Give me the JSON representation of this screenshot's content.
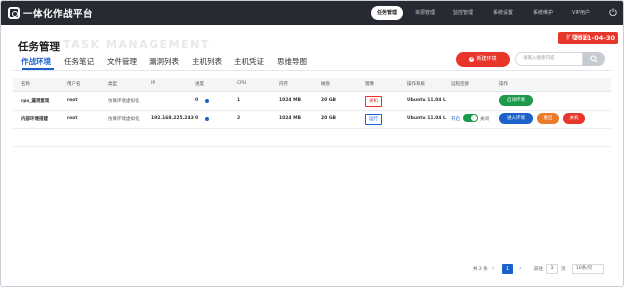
{
  "header": {
    "app_title": "一体化作战平台",
    "nav": [
      "任务管理",
      "资源管理",
      "监控管理",
      "系统设置",
      "系统维护",
      "VIP用户"
    ],
    "active_nav": "任务管理"
  },
  "date_tag": {
    "label": "扩展时间",
    "value": "2021-04-30"
  },
  "page": {
    "title": "任务管理",
    "subtitle": "TASK MANAGEMENT",
    "tabs": [
      "作战环境",
      "任务笔记",
      "文件管理",
      "漏洞列表",
      "主机列表",
      "主机凭证",
      "思维导图"
    ],
    "active_tab": "作战环境"
  },
  "toolbar": {
    "new_label": "新建环境",
    "search_placeholder": "请输入搜索内容"
  },
  "table": {
    "headers": [
      "名称",
      "用户名",
      "类型",
      "IP",
      "进度",
      "CPU",
      "内存",
      "磁盘",
      "镜像",
      "操作系统",
      "远程连接",
      "操作"
    ],
    "rows": [
      {
        "name": "rps_漏洞复现",
        "user": "root",
        "type": "仿真环境虚拟化",
        "ip": "",
        "progress": "0",
        "cpu": "1",
        "mem": "1024 MB",
        "disk": "20 GB",
        "image_tag": "关机",
        "os": "Ubuntu 11.04 L",
        "remote": "",
        "actions": [
          "启动环境"
        ]
      },
      {
        "name": "内部环境搭建",
        "user": "root",
        "type": "仿真环境虚拟化",
        "ip": "192.168.225.243",
        "progress": "0",
        "cpu": "2",
        "mem": "1024 MB",
        "disk": "20 GB",
        "image_tag": "运行",
        "os": "Ubuntu 11.04 L",
        "remote_label_on": "开启",
        "remote_label_off": "关闭",
        "actions": [
          "进入环境",
          "重启",
          "关机"
        ]
      }
    ]
  },
  "pagination": {
    "total_text": "共 2 条",
    "current_page": "1",
    "goto_label": "前往",
    "goto_value": "1",
    "unit": "页",
    "page_size": "10条/页"
  },
  "colors": {
    "topbar": "#272a33",
    "accent_blue": "#1a62c9",
    "accent_red": "#e8362a",
    "green": "#1a9a4a",
    "orange": "#ec7a2b"
  }
}
